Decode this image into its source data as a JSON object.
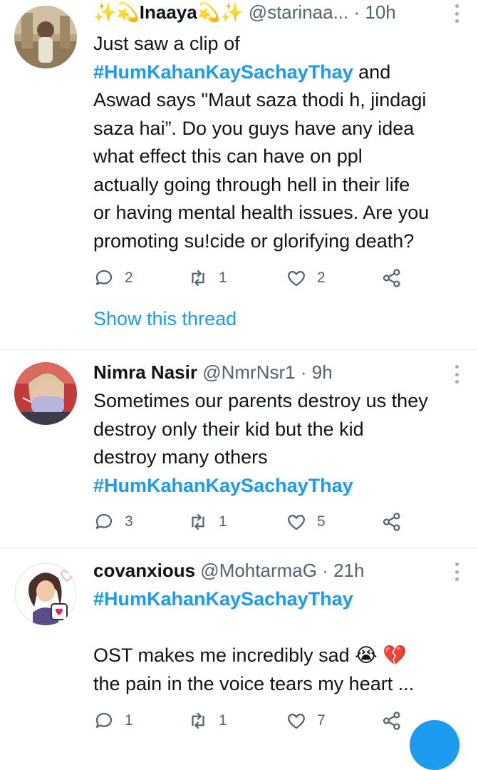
{
  "tweets": [
    {
      "name": "Inaaya",
      "name_prefix": "✨💫",
      "name_suffix": "💫✨",
      "handle": "@starinaa...",
      "dot": "·",
      "time": "10h",
      "lines": [
        "Just saw a clip of",
        "",
        "Aswad says \"Maut saza thodi h, jindagi",
        "saza hai”. Do you guys have any idea",
        "what effect this can have on ppl",
        "actually going through hell in their life",
        "or having mental health issues. Are you",
        "promoting su!cide or glorifying death?"
      ],
      "hashtag": "#HumKahanKaySachayThay",
      "after_hashtag": " and",
      "replies": "2",
      "retweets": "1",
      "likes": "2",
      "show_thread": "Show this thread"
    },
    {
      "name": "Nimra Nasir",
      "handle": "@NmrNsr1",
      "dot": "·",
      "time": "9h",
      "lines": [
        "Sometimes our parents destroy us they",
        "destroy only their kid but the kid",
        "destroy many others"
      ],
      "hashtag": "#HumKahanKaySachayThay",
      "replies": "3",
      "retweets": "1",
      "likes": "5"
    },
    {
      "name": "covanxious",
      "handle": "@MohtarmaG",
      "dot": "·",
      "time": "21h",
      "hashtag": "#HumKahanKaySachayThay",
      "lines": [
        "OST makes me incredibly sad 😭 💔",
        "the pain in the voice tears my heart ..."
      ],
      "replies": "1",
      "retweets": "1",
      "likes": "7"
    }
  ],
  "icons": {
    "reply": "reply-icon",
    "retweet": "retweet-icon",
    "like": "like-icon",
    "share": "share-icon",
    "more": "more-options-icon"
  },
  "colors": {
    "accent": "#1d9bf0",
    "text": "#0f1419",
    "secondary": "#536471",
    "divider": "#e6e9ec"
  }
}
